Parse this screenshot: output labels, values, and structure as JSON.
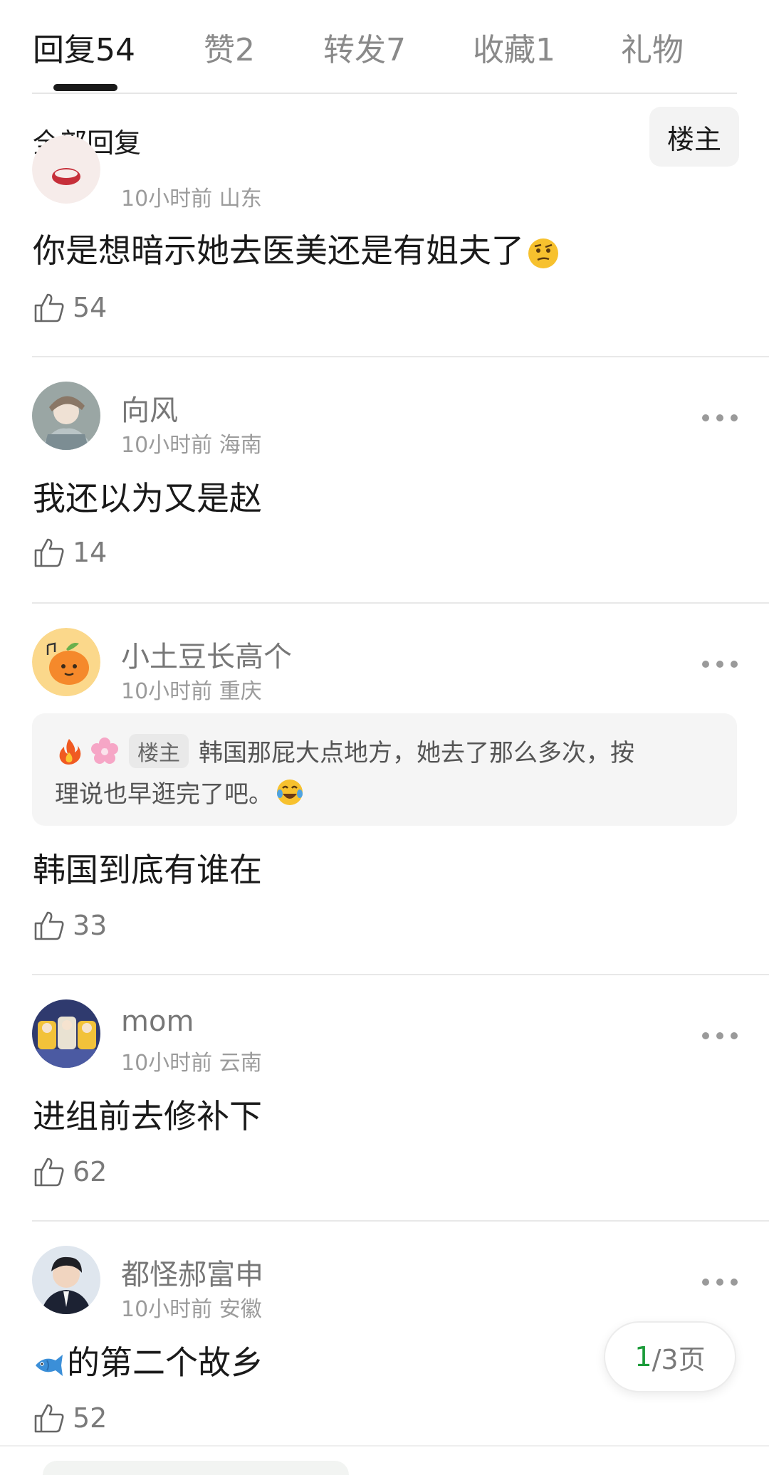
{
  "tabs": [
    {
      "label": "回复",
      "count": "54"
    },
    {
      "label": "赞",
      "count": "2"
    },
    {
      "label": "转发",
      "count": "7"
    },
    {
      "label": "收藏",
      "count": "1"
    },
    {
      "label": "礼物",
      "count": ""
    }
  ],
  "filter": {
    "label": "全部回复",
    "op_button": "楼主"
  },
  "comments": [
    {
      "username": "",
      "time": "10小时前",
      "location": "山东",
      "content": "你是想暗示她去医美还是有姐夫了",
      "content_emoji": "thinking-face",
      "likes": "54"
    },
    {
      "username": "向风",
      "time": "10小时前",
      "location": "海南",
      "content": "我还以为又是赵",
      "likes": "14"
    },
    {
      "username": "小土豆长高个",
      "time": "10小时前",
      "location": "重庆",
      "content": "韩国到底有谁在",
      "likes": "33",
      "quote": {
        "badge": "楼主",
        "line1": "韩国那屁大点地方，她去了那么多次，按",
        "line2": "理说也早逛完了吧。",
        "emojis": [
          "fire-emoji",
          "cherry-blossom-emoji",
          "laughing-tears-emoji"
        ]
      }
    },
    {
      "username": "mom",
      "time": "10小时前",
      "location": "云南",
      "content": "进组前去修补下",
      "likes": "62"
    },
    {
      "username": "都怪郝富申",
      "time": "10小时前",
      "location": "安徽",
      "content": "的第二个故乡",
      "content_prefix_emoji": "fish-emoji",
      "likes": "52"
    }
  ],
  "pagination": {
    "current": "1",
    "rest": "/3页"
  },
  "colors": {
    "accent_green": "#1c9b3a",
    "text_primary": "#1a1a1a",
    "text_secondary": "#9b9b9b"
  }
}
